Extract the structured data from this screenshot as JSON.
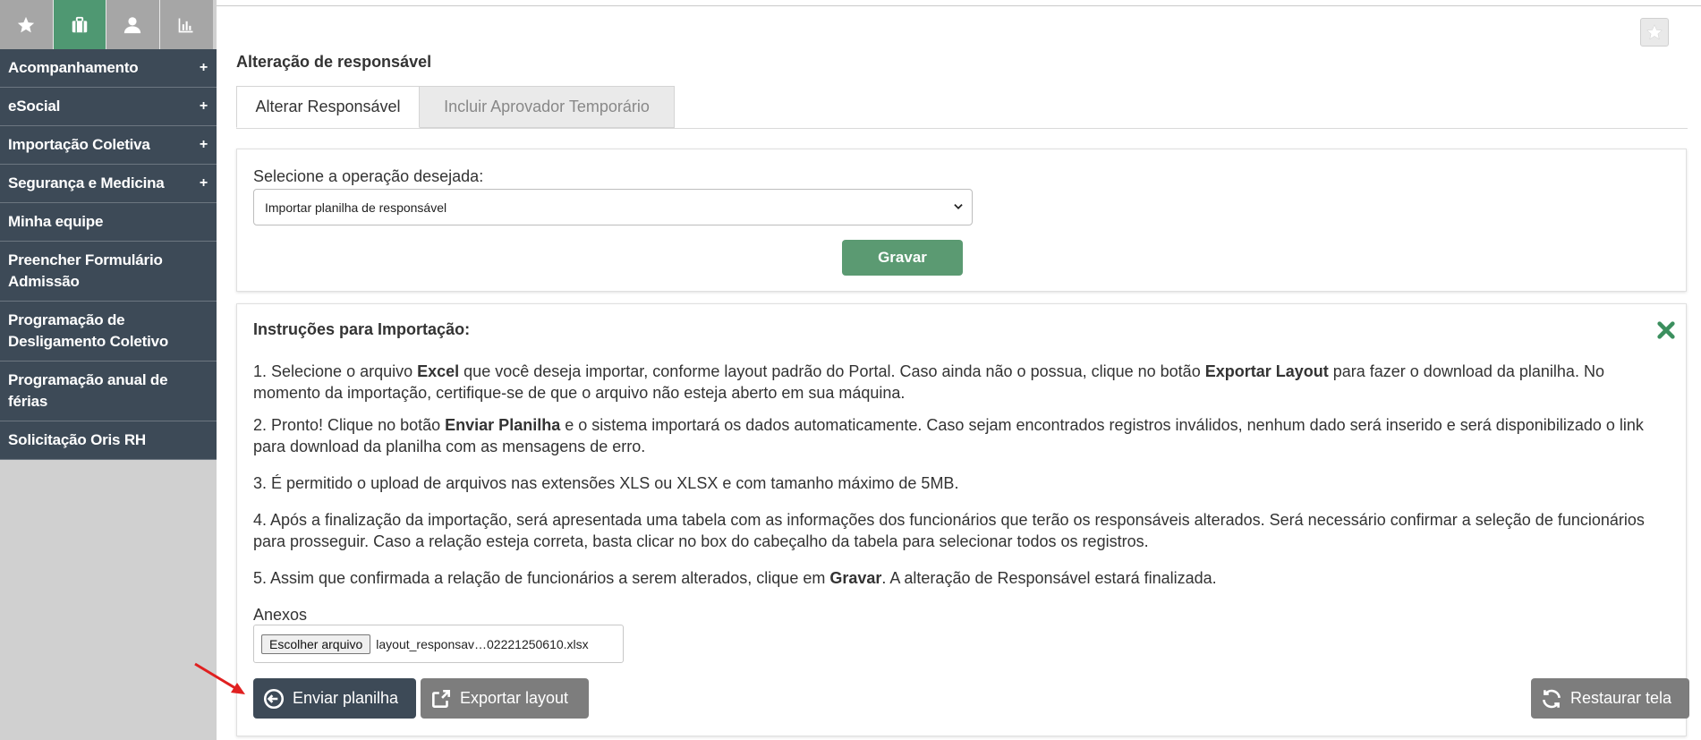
{
  "sidebar": {
    "top_icons": [
      {
        "icon": "star-icon",
        "active": false
      },
      {
        "icon": "briefcase-icon",
        "active": true
      },
      {
        "icon": "user-icon",
        "active": false
      },
      {
        "icon": "chart-icon",
        "active": false
      }
    ],
    "items": [
      {
        "label": "Acompanhamento",
        "expandable": true
      },
      {
        "label": "eSocial",
        "expandable": true
      },
      {
        "label": "Importação Coletiva",
        "expandable": true
      },
      {
        "label": "Segurança e Medicina",
        "expandable": true
      },
      {
        "label": "Minha equipe",
        "expandable": false
      },
      {
        "label": "Preencher Formulário Admissão",
        "expandable": false
      },
      {
        "label": "Programação de Desligamento Coletivo",
        "expandable": false
      },
      {
        "label": "Programação anual de férias",
        "expandable": false
      },
      {
        "label": "Solicitação Oris RH",
        "expandable": false
      }
    ],
    "expand_symbol": "+"
  },
  "page": {
    "title": "Alteração de responsável",
    "tabs": [
      {
        "label": "Alterar Responsável",
        "active": true
      },
      {
        "label": "Incluir Aprovador Temporário",
        "active": false
      }
    ]
  },
  "operation": {
    "label": "Selecione a operação desejada:",
    "selected": "Importar planilha de responsável",
    "save_label": "Gravar"
  },
  "instructions": {
    "title": "Instruções para Importação:",
    "p1": {
      "a": "1. Selecione o arquivo ",
      "b": "Excel",
      "c": " que você deseja importar, conforme layout padrão do Portal. Caso ainda não o possua, clique no botão ",
      "d": "Exportar Layout",
      "e": " para fazer o download da planilha. No momento da importação, certifique-se de que o arquivo não esteja aberto em sua máquina."
    },
    "p2": {
      "a": "2. Pronto! Clique no botão ",
      "b": "Enviar Planilha",
      "c": " e o sistema importará os dados automaticamente. Caso sejam encontrados registros inválidos, nenhum dado será inserido e será disponibilizado o link para download da planilha com as mensagens de erro."
    },
    "p3": "3. É permitido o upload de arquivos nas extensões XLS ou XLSX e com tamanho máximo de 5MB.",
    "p4": "4. Após a finalização da importação, será apresentada uma tabela com as informações dos funcionários que terão os responsáveis alterados. Será necessário confirmar a seleção de funcionários para prosseguir. Caso a relação esteja correta, basta clicar no box do cabeçalho da tabela para selecionar todos os registros.",
    "p5": {
      "a": "5. Assim que confirmada a relação de funcionários a serem alterados, clique em ",
      "b": "Gravar",
      "c": ". A alteração de Responsável estará finalizada."
    }
  },
  "attachments": {
    "label": "Anexos",
    "choose_label": "Escolher arquivo",
    "file_name": "layout_responsav…02221250610.xlsx"
  },
  "buttons": {
    "send": "Enviar planilha",
    "export": "Exportar layout",
    "reset": "Restaurar tela"
  },
  "colors": {
    "sidebar_dark": "#3d4a57",
    "accent_green": "#5b9a72",
    "close_green": "#3b8f5e",
    "annotation_red": "#e02020"
  }
}
